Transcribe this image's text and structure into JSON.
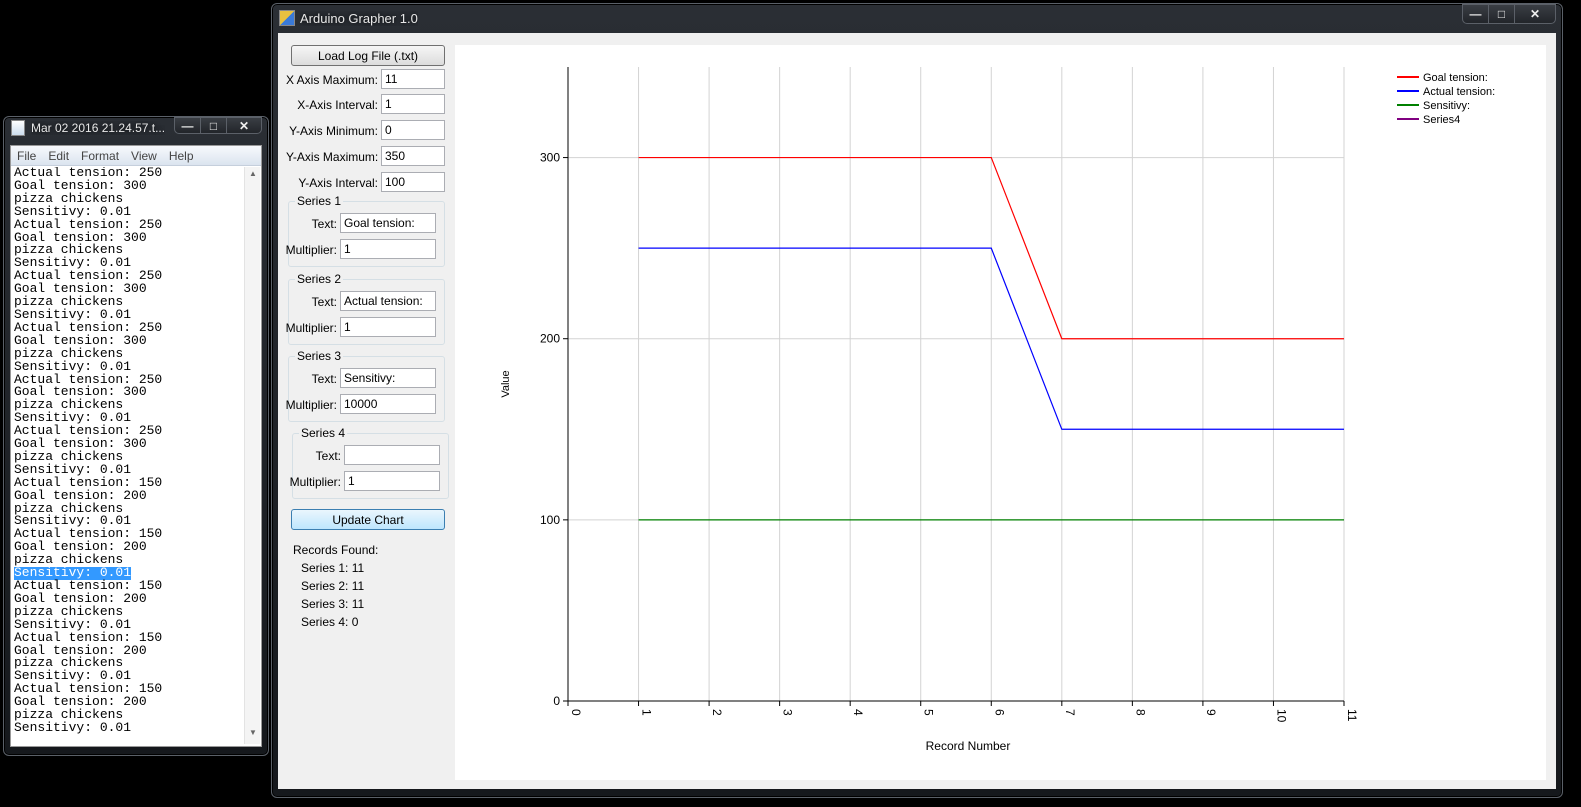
{
  "notepad": {
    "title": "Mar 02 2016 21.24.57.t...",
    "menu": [
      "File",
      "Edit",
      "Format",
      "View",
      "Help"
    ],
    "lines": [
      "Actual tension: 250",
      "Goal tension: 300",
      "pizza chickens",
      "Sensitivy: 0.01",
      "Actual tension: 250",
      "Goal tension: 300",
      "pizza chickens",
      "Sensitivy: 0.01",
      "Actual tension: 250",
      "Goal tension: 300",
      "pizza chickens",
      "Sensitivy: 0.01",
      "Actual tension: 250",
      "Goal tension: 300",
      "pizza chickens",
      "Sensitivy: 0.01",
      "Actual tension: 250",
      "Goal tension: 300",
      "pizza chickens",
      "Sensitivy: 0.01",
      "Actual tension: 250",
      "Goal tension: 300",
      "pizza chickens",
      "Sensitivy: 0.01",
      "Actual tension: 150",
      "Goal tension: 200",
      "pizza chickens",
      "Sensitivy: 0.01",
      "Actual tension: 150",
      "Goal tension: 200",
      "pizza chickens",
      "Sensitivy: 0.01",
      "Actual tension: 150",
      "Goal tension: 200",
      "pizza chickens",
      "Sensitivy: 0.01",
      "Actual tension: 150",
      "Goal tension: 200",
      "pizza chickens",
      "Sensitivy: 0.01",
      "Actual tension: 150",
      "Goal tension: 200",
      "pizza chickens",
      "Sensitivy: 0.01"
    ],
    "selected_line": 31
  },
  "grapher": {
    "title": "Arduino Grapher 1.0",
    "load_button": "Load Log File (.txt)",
    "update_button": "Update Chart",
    "fields": {
      "x_max_label": "X Axis Maximum:",
      "x_max": "11",
      "x_int_label": "X-Axis Interval:",
      "x_int": "1",
      "y_min_label": "Y-Axis Minimum:",
      "y_min": "0",
      "y_max_label": "Y-Axis Maximum:",
      "y_max": "350",
      "y_int_label": "Y-Axis Interval:",
      "y_int": "100"
    },
    "series_groups": [
      {
        "title": "Series 1",
        "text_label": "Text:",
        "text": "Goal tension:",
        "mult_label": "Multiplier:",
        "mult": "1"
      },
      {
        "title": "Series 2",
        "text_label": "Text:",
        "text": "Actual tension:",
        "mult_label": "Multiplier:",
        "mult": "1"
      },
      {
        "title": "Series 3",
        "text_label": "Text:",
        "text": "Sensitivy:",
        "mult_label": "Multiplier:",
        "mult": "10000"
      },
      {
        "title": "Series 4",
        "text_label": "Text:",
        "text": "",
        "mult_label": "Multiplier:",
        "mult": "1"
      }
    ],
    "records": {
      "heading": "Records Found:",
      "lines": [
        "Series 1: 11",
        "Series 2: 11",
        "Series 3: 11",
        "Series 4: 0"
      ]
    }
  },
  "chart_data": {
    "type": "line",
    "xlabel": "Record Number",
    "ylabel": "Value",
    "xlim": [
      0,
      11
    ],
    "ylim": [
      0,
      350
    ],
    "x_ticks": [
      0,
      1,
      2,
      3,
      4,
      5,
      6,
      7,
      8,
      9,
      10,
      11
    ],
    "y_ticks": [
      0,
      100,
      200,
      300
    ],
    "grid": true,
    "legend": "top-right",
    "series": [
      {
        "name": "Goal tension:",
        "color": "#ff0000",
        "x": [
          1,
          2,
          3,
          4,
          5,
          6,
          7,
          8,
          9,
          10,
          11
        ],
        "values": [
          300,
          300,
          300,
          300,
          300,
          300,
          200,
          200,
          200,
          200,
          200
        ]
      },
      {
        "name": "Actual tension:",
        "color": "#0000ff",
        "x": [
          1,
          2,
          3,
          4,
          5,
          6,
          7,
          8,
          9,
          10,
          11
        ],
        "values": [
          250,
          250,
          250,
          250,
          250,
          250,
          150,
          150,
          150,
          150,
          150
        ]
      },
      {
        "name": "Sensitivy:",
        "color": "#008000",
        "x": [
          1,
          2,
          3,
          4,
          5,
          6,
          7,
          8,
          9,
          10,
          11
        ],
        "values": [
          100,
          100,
          100,
          100,
          100,
          100,
          100,
          100,
          100,
          100,
          100
        ]
      },
      {
        "name": "Series4",
        "color": "#800080",
        "x": [],
        "values": []
      }
    ]
  }
}
